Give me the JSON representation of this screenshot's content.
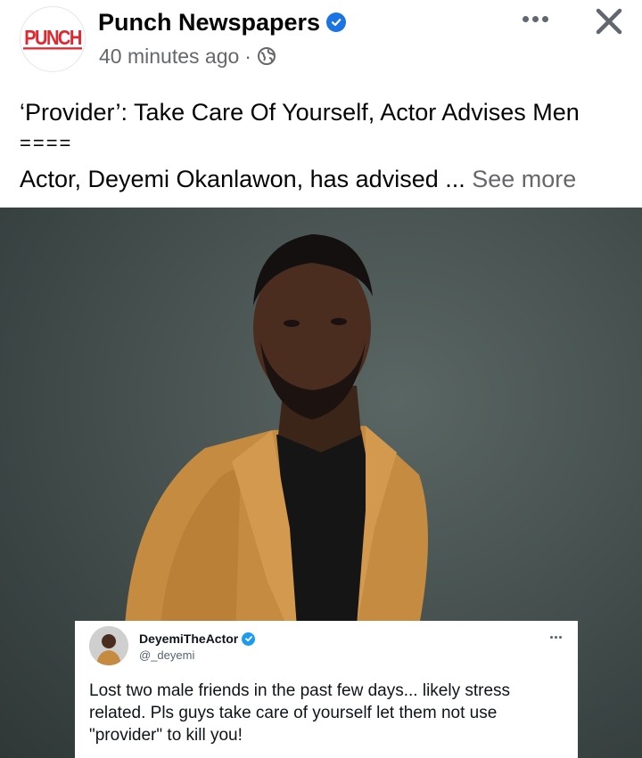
{
  "post": {
    "page_name": "Punch Newspapers",
    "logo_text": "PUNCH",
    "timestamp": "40 minutes ago",
    "separator": "·",
    "audience_icon": "globe-icon",
    "headline": "‘Provider’: Take Care Of Yourself, Actor Advises Men",
    "divider": "====",
    "excerpt": "Actor, Deyemi Okanlawon, has advised ... ",
    "see_more": "See more"
  },
  "tweet": {
    "display_name": "DeyemiTheActor",
    "handle": "@_deyemi",
    "text": "Lost two male friends in the past few days... likely stress related. Pls guys take care of yourself let them not use \"provider\" to kill you!"
  },
  "colors": {
    "punch_red": "#e3262d",
    "fb_verified_blue": "#1b74e4",
    "twitter_verified_blue": "#1d9bf0",
    "secondary_text": "#65676b",
    "jacket_mustard": "#c58b40"
  }
}
